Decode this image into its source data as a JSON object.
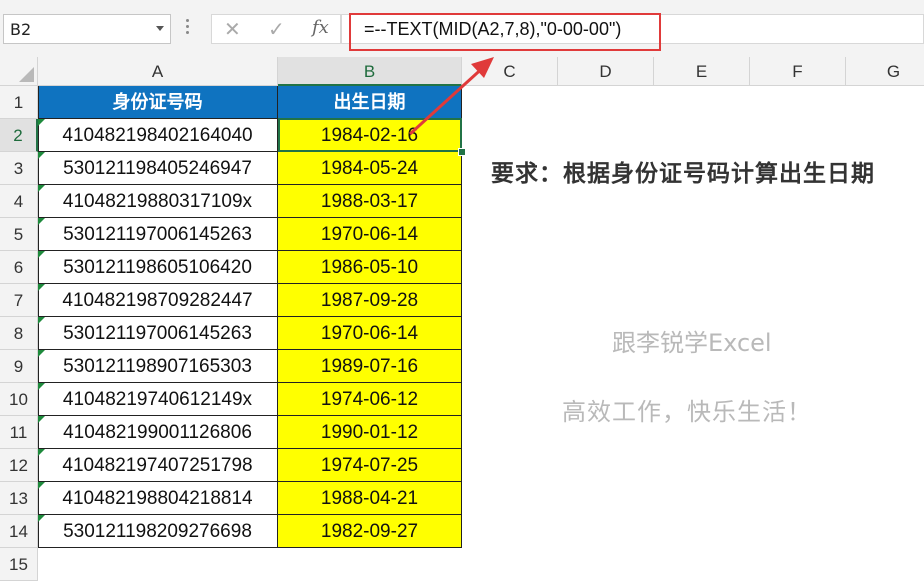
{
  "formula_bar": {
    "name_box": "B2",
    "cancel_icon": "✕",
    "enter_icon": "✓",
    "fx_label": "fx",
    "formula": "=--TEXT(MID(A2,7,8),\"0-00-00\")"
  },
  "columns": [
    "A",
    "B",
    "C",
    "D",
    "E",
    "F",
    "G"
  ],
  "rows": [
    "1",
    "2",
    "3",
    "4",
    "5",
    "6",
    "7",
    "8",
    "9",
    "10",
    "11",
    "12",
    "13",
    "14",
    "15"
  ],
  "table": {
    "headers": [
      "身份证号码",
      "出生日期"
    ],
    "rows": [
      {
        "id": "410482198402164040",
        "dob": "1984-02-16"
      },
      {
        "id": "530121198405246947",
        "dob": "1984-05-24"
      },
      {
        "id": "41048219880317109x",
        "dob": "1988-03-17"
      },
      {
        "id": "530121197006145263",
        "dob": "1970-06-14"
      },
      {
        "id": "530121198605106420",
        "dob": "1986-05-10"
      },
      {
        "id": "410482198709282447",
        "dob": "1987-09-28"
      },
      {
        "id": "530121197006145263",
        "dob": "1970-06-14"
      },
      {
        "id": "530121198907165303",
        "dob": "1989-07-16"
      },
      {
        "id": "41048219740612149x",
        "dob": "1974-06-12"
      },
      {
        "id": "410482199001126806",
        "dob": "1990-01-12"
      },
      {
        "id": "410482197407251798",
        "dob": "1974-07-25"
      },
      {
        "id": "410482198804218814",
        "dob": "1988-04-21"
      },
      {
        "id": "530121198209276698",
        "dob": "1982-09-27"
      }
    ]
  },
  "requirement": "要求：根据身份证号码计算出生日期",
  "watermark": {
    "line1": "跟李锐学Excel",
    "line2": "高效工作，快乐生活！"
  },
  "colors": {
    "header_fill": "#0f73c0",
    "date_fill": "#ffff00",
    "highlight_red": "#e03a3a",
    "selection_green": "#217346"
  }
}
